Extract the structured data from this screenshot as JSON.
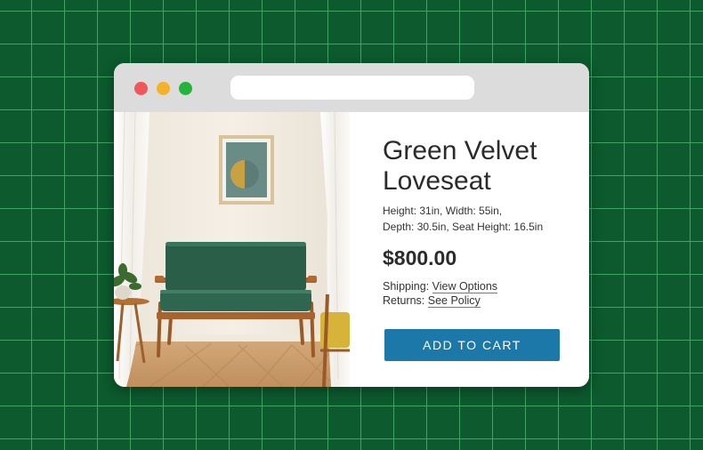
{
  "window": {
    "controls": [
      "close",
      "minimize",
      "maximize"
    ],
    "address_bar": {
      "value": ""
    }
  },
  "product": {
    "image_alt": "Green velvet loveseat with wooden frame in a bright room",
    "title_line1": "Green Velvet",
    "title_line2": "Loveseat",
    "dimensions_line1": "Height: 31in, Width: 55in,",
    "dimensions_line2": "Depth: 30.5in, Seat Height: 16.5in",
    "price": "$800.00",
    "shipping_label": "Shipping:",
    "shipping_link": "View Options",
    "returns_label": "Returns:",
    "returns_link": "See Policy",
    "cta": "ADD TO CART"
  },
  "colors": {
    "background": "#0c5a2e",
    "grid": "#3fa362",
    "button": "#1c78a8",
    "sofa": "#2a5e49",
    "wood": "#a8642c"
  }
}
